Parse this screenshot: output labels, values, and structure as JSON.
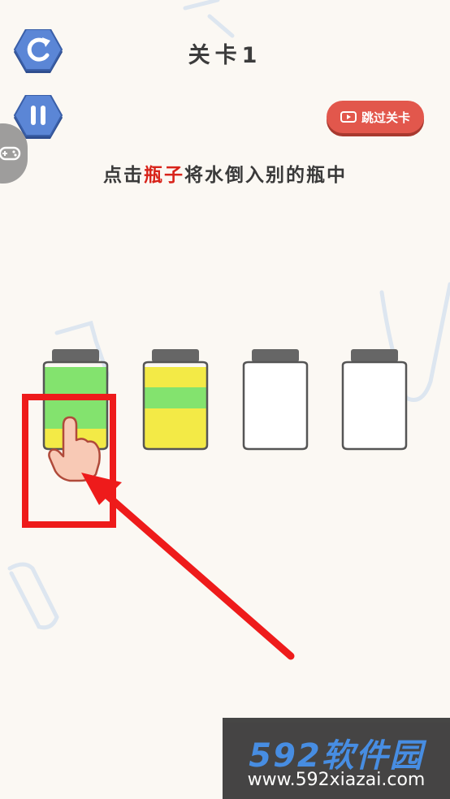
{
  "header": {
    "level_title": "关卡1"
  },
  "toolbar": {
    "restart_icon": "restart-icon",
    "pause_icon": "pause-icon",
    "controller_icon": "gamepad-icon"
  },
  "skip_button": {
    "label": "跳过关卡",
    "icon": "video-icon"
  },
  "instruction": {
    "before": "点击",
    "highlight": "瓶子",
    "after": "将水倒入别的瓶中"
  },
  "bottles": [
    {
      "layers_bottom_to_top": [
        "yellow",
        "green",
        "green"
      ]
    },
    {
      "layers_bottom_to_top": [
        "yellow",
        "green",
        "yellow"
      ]
    },
    {
      "layers_bottom_to_top": []
    },
    {
      "layers_bottom_to_top": []
    }
  ],
  "watermark": {
    "brand": "592软件园",
    "url": "www.592xiazai.com"
  },
  "colors": {
    "background": "#fbf8f3",
    "hex_button": "#4f78c8",
    "yellow_liquid": "#f3ea46",
    "green_liquid": "#83e36e",
    "highlight_red": "#d8231a",
    "skip_button": "#e2574c"
  }
}
